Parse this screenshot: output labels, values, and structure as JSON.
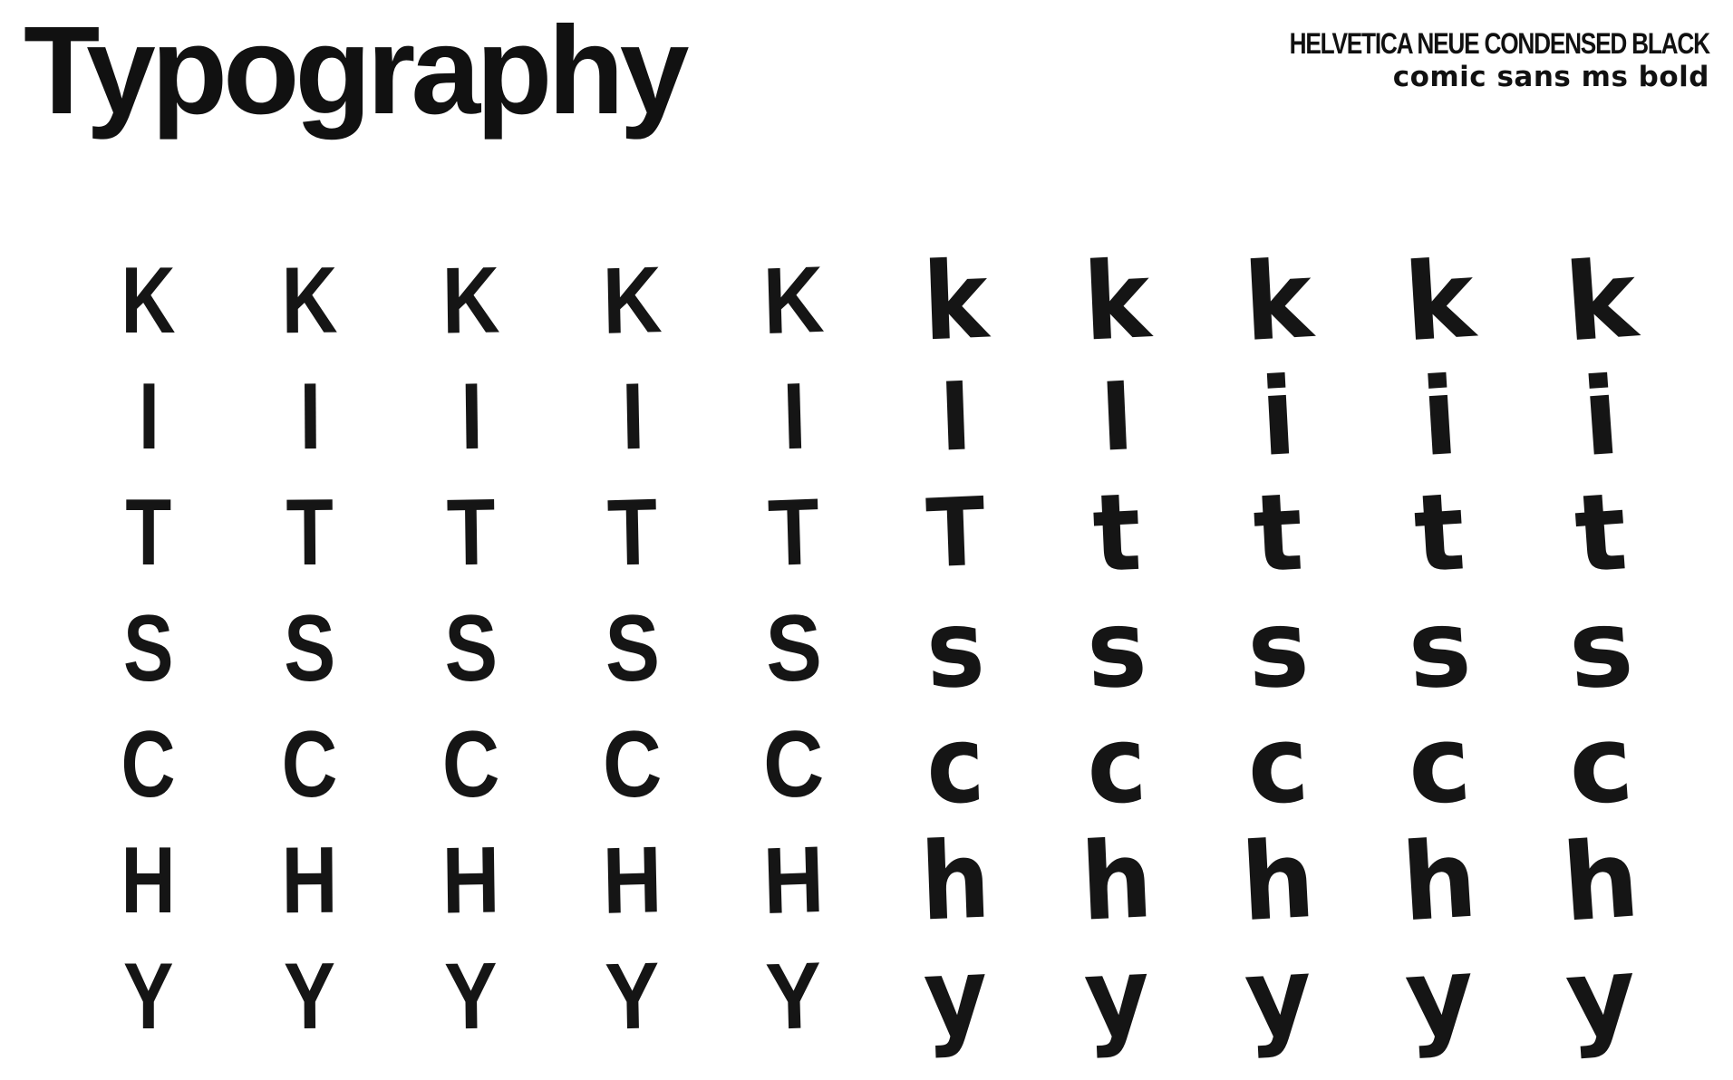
{
  "title": "Typography",
  "font_labels": {
    "primary": "HELVETICA NEUE CONDENSED BLACK",
    "secondary": "comic sans ms bold"
  },
  "glyph_rows": [
    [
      "K",
      "K",
      "K",
      "K",
      "K",
      "k",
      "k",
      "k",
      "k",
      "k"
    ],
    [
      "I",
      "I",
      "I",
      "I",
      "I",
      "I",
      "I",
      "i",
      "i",
      "i"
    ],
    [
      "T",
      "T",
      "T",
      "T",
      "T",
      "T",
      "t",
      "t",
      "t",
      "t"
    ],
    [
      "S",
      "S",
      "S",
      "S",
      "S",
      "s",
      "s",
      "s",
      "s",
      "s"
    ],
    [
      "C",
      "C",
      "C",
      "C",
      "C",
      "c",
      "c",
      "c",
      "c",
      "c"
    ],
    [
      "H",
      "H",
      "H",
      "H",
      "H",
      "h",
      "h",
      "h",
      "h",
      "h"
    ],
    [
      "Y",
      "Y",
      "Y",
      "Y",
      "Y",
      "y",
      "y",
      "y",
      "y",
      "y"
    ]
  ]
}
